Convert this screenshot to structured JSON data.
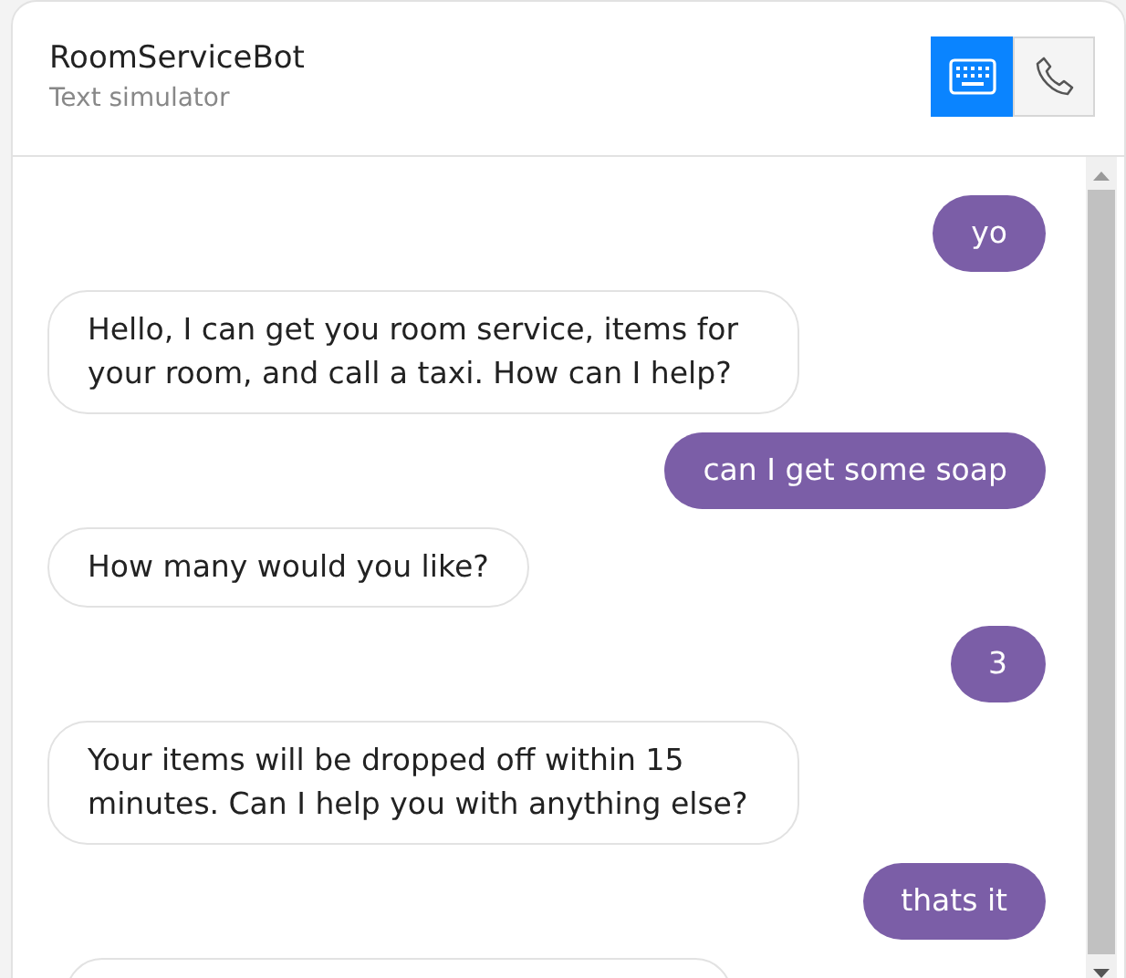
{
  "header": {
    "title": "RoomServiceBot",
    "subtitle": "Text simulator"
  },
  "modes": [
    {
      "kind": "keyboard",
      "selected": true
    },
    {
      "kind": "phone",
      "selected": false
    }
  ],
  "messages": [
    {
      "kind": "user",
      "text": "yo"
    },
    {
      "kind": "bot",
      "text": "Hello, I can get you room service, items for your room, and call a taxi. How can I help?"
    },
    {
      "kind": "user",
      "text": "can I get some soap"
    },
    {
      "kind": "bot",
      "text": "How many would you like?"
    },
    {
      "kind": "user",
      "text": "3"
    },
    {
      "kind": "bot",
      "text": "Your items will be dropped off within 15 minutes. Can I help you with anything else?"
    },
    {
      "kind": "user",
      "text": "thats it"
    },
    {
      "kind": "bot_partial"
    }
  ]
}
